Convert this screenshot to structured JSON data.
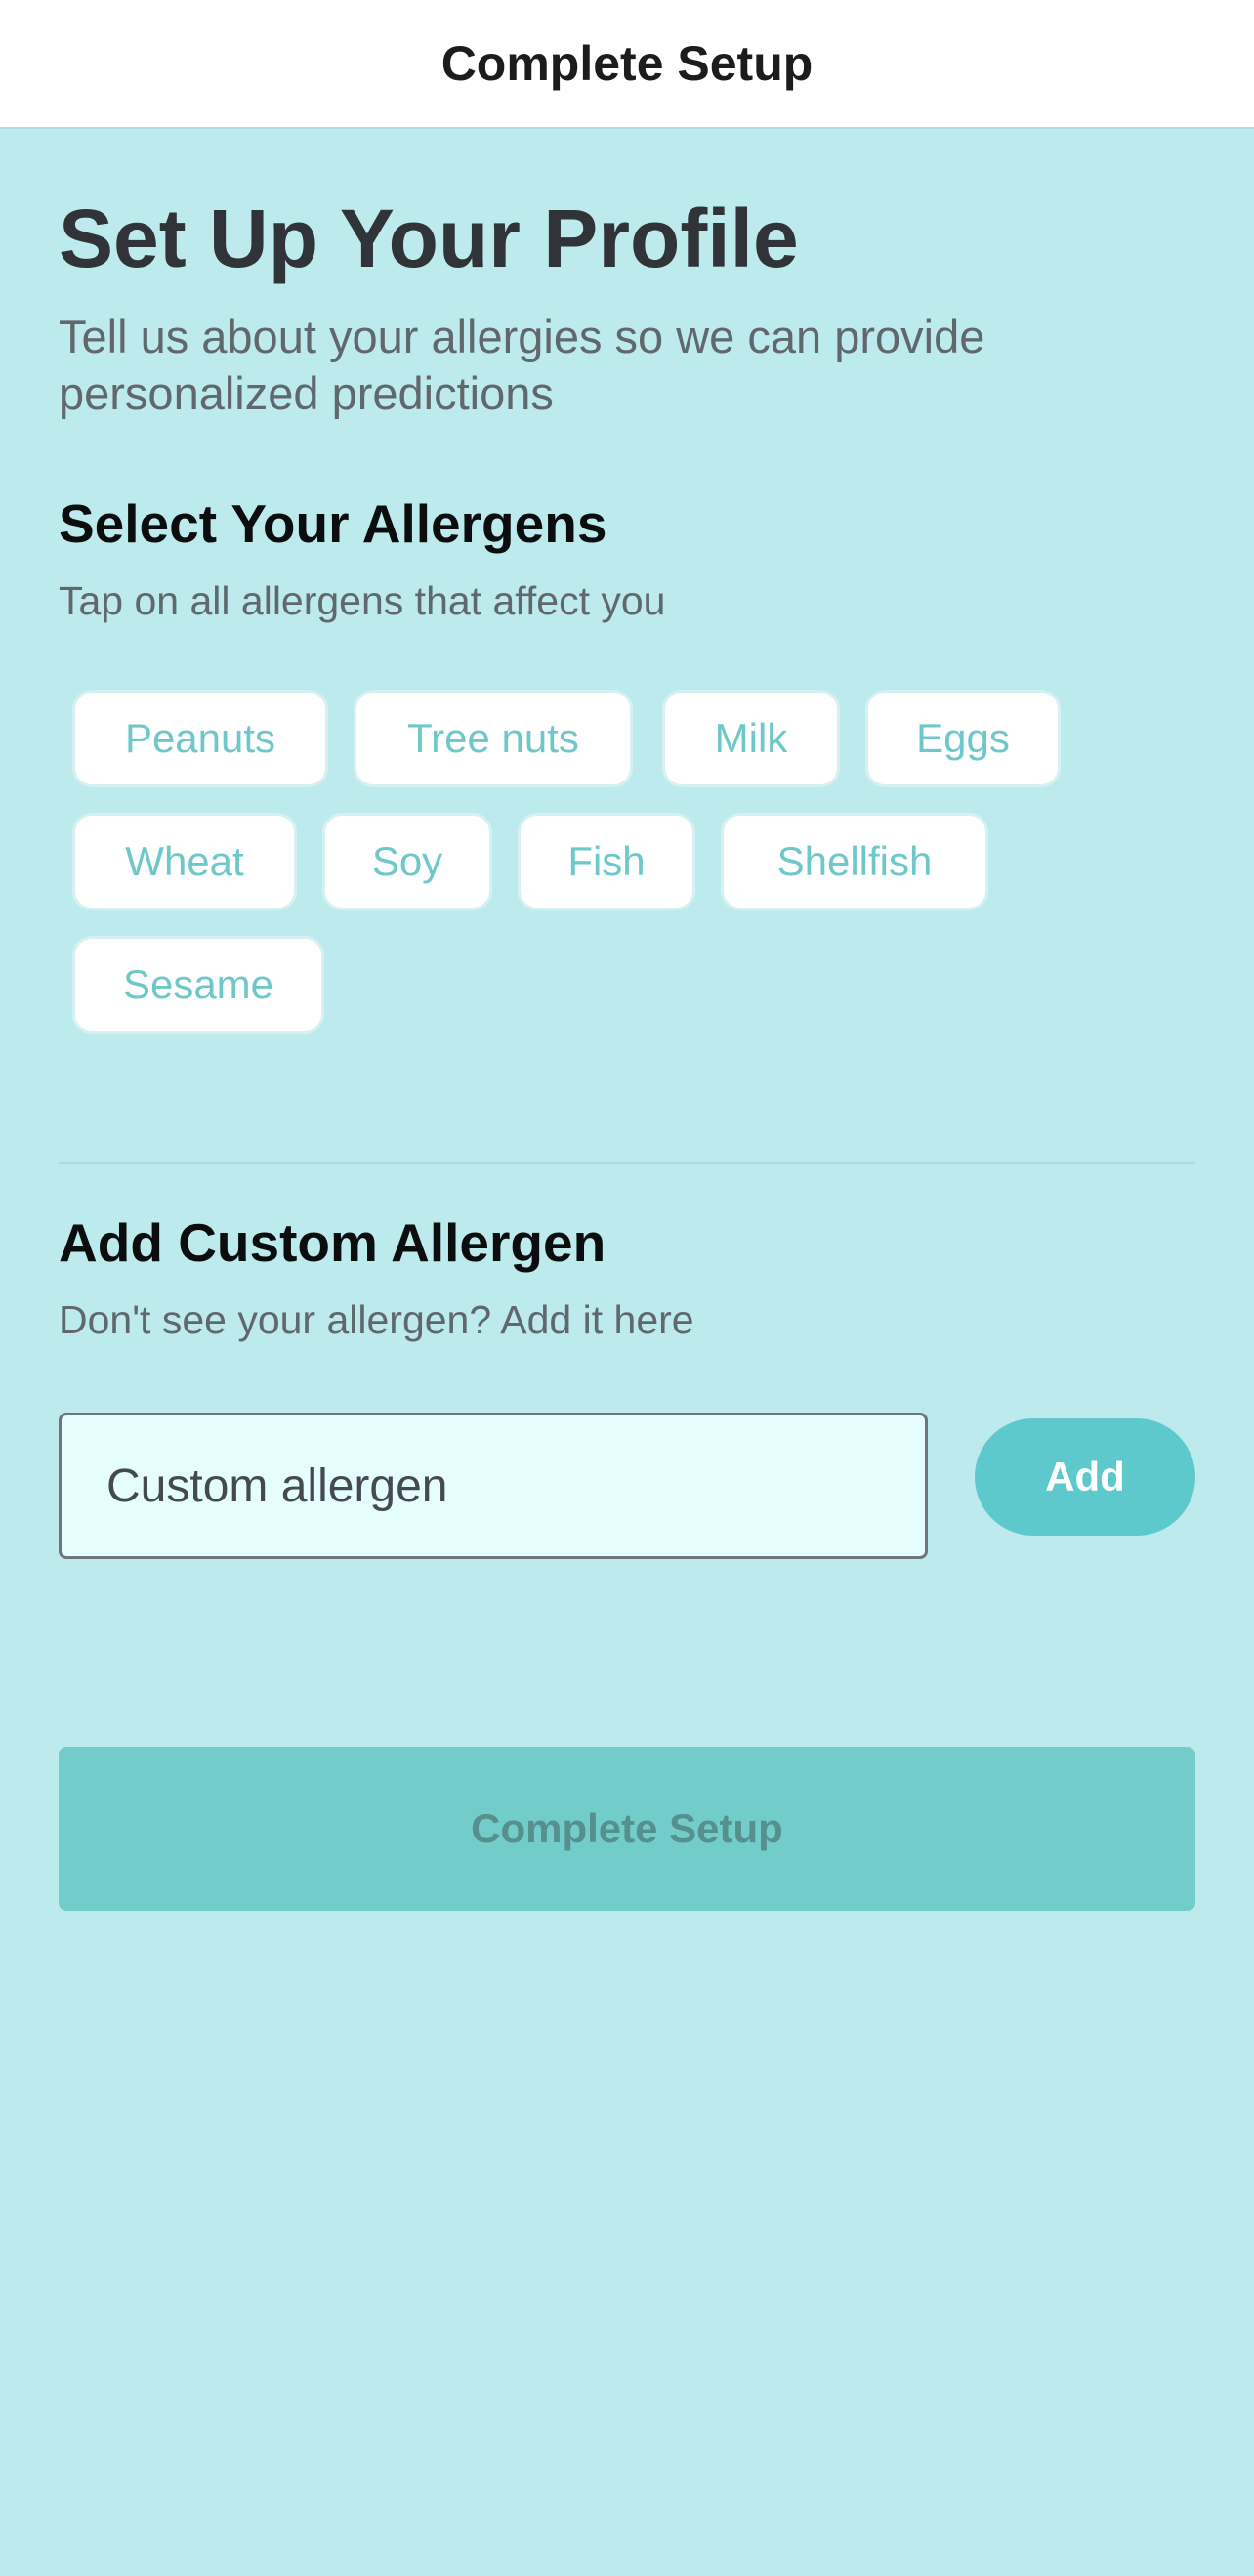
{
  "nav": {
    "title": "Complete Setup"
  },
  "header": {
    "title": "Set Up Your Profile",
    "subtitle": "Tell us about your allergies so we can provide personalized predictions"
  },
  "allergens": {
    "title": "Select Your Allergens",
    "hint": "Tap on all allergens that affect you",
    "items": [
      {
        "label": "Peanuts",
        "selected": false
      },
      {
        "label": "Tree nuts",
        "selected": false
      },
      {
        "label": "Milk",
        "selected": false
      },
      {
        "label": "Eggs",
        "selected": false
      },
      {
        "label": "Wheat",
        "selected": false
      },
      {
        "label": "Soy",
        "selected": false
      },
      {
        "label": "Fish",
        "selected": false
      },
      {
        "label": "Shellfish",
        "selected": false
      },
      {
        "label": "Sesame",
        "selected": false
      }
    ]
  },
  "custom": {
    "title": "Add Custom Allergen",
    "hint": "Don't see your allergen? Add it here",
    "input_value": "",
    "input_placeholder": "Custom allergen",
    "add_label": "Add"
  },
  "footer": {
    "complete_label": "Complete Setup"
  },
  "colors": {
    "background": "#bdeaec",
    "accent": "#5ec9cc",
    "chip_text": "#6ec8c9",
    "complete_button": "#72cdca"
  }
}
